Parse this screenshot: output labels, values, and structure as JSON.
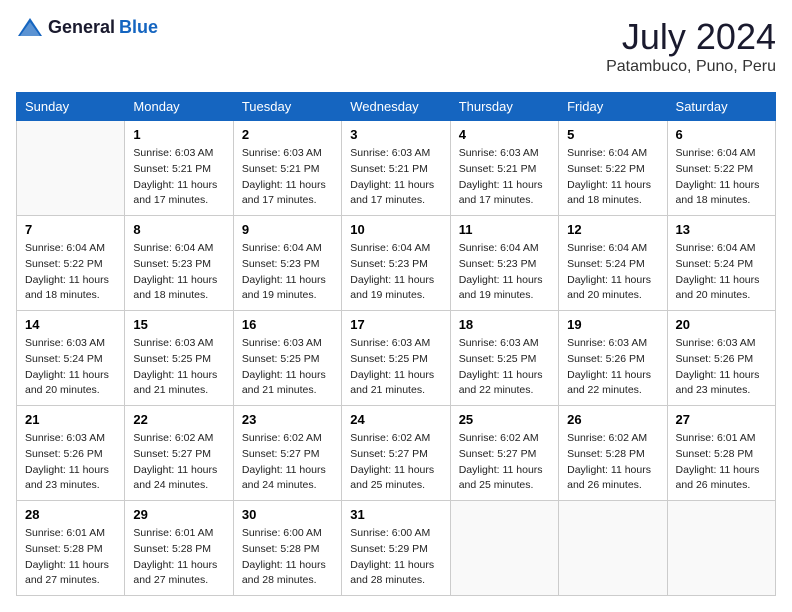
{
  "header": {
    "logo": {
      "general": "General",
      "blue": "Blue"
    },
    "title": "July 2024",
    "location": "Patambuco, Puno, Peru"
  },
  "weekdays": [
    "Sunday",
    "Monday",
    "Tuesday",
    "Wednesday",
    "Thursday",
    "Friday",
    "Saturday"
  ],
  "weeks": [
    [
      {
        "day": "",
        "info": ""
      },
      {
        "day": "1",
        "info": "Sunrise: 6:03 AM\nSunset: 5:21 PM\nDaylight: 11 hours\nand 17 minutes."
      },
      {
        "day": "2",
        "info": "Sunrise: 6:03 AM\nSunset: 5:21 PM\nDaylight: 11 hours\nand 17 minutes."
      },
      {
        "day": "3",
        "info": "Sunrise: 6:03 AM\nSunset: 5:21 PM\nDaylight: 11 hours\nand 17 minutes."
      },
      {
        "day": "4",
        "info": "Sunrise: 6:03 AM\nSunset: 5:21 PM\nDaylight: 11 hours\nand 17 minutes."
      },
      {
        "day": "5",
        "info": "Sunrise: 6:04 AM\nSunset: 5:22 PM\nDaylight: 11 hours\nand 18 minutes."
      },
      {
        "day": "6",
        "info": "Sunrise: 6:04 AM\nSunset: 5:22 PM\nDaylight: 11 hours\nand 18 minutes."
      }
    ],
    [
      {
        "day": "7",
        "info": "Sunrise: 6:04 AM\nSunset: 5:22 PM\nDaylight: 11 hours\nand 18 minutes."
      },
      {
        "day": "8",
        "info": "Sunrise: 6:04 AM\nSunset: 5:23 PM\nDaylight: 11 hours\nand 18 minutes."
      },
      {
        "day": "9",
        "info": "Sunrise: 6:04 AM\nSunset: 5:23 PM\nDaylight: 11 hours\nand 19 minutes."
      },
      {
        "day": "10",
        "info": "Sunrise: 6:04 AM\nSunset: 5:23 PM\nDaylight: 11 hours\nand 19 minutes."
      },
      {
        "day": "11",
        "info": "Sunrise: 6:04 AM\nSunset: 5:23 PM\nDaylight: 11 hours\nand 19 minutes."
      },
      {
        "day": "12",
        "info": "Sunrise: 6:04 AM\nSunset: 5:24 PM\nDaylight: 11 hours\nand 20 minutes."
      },
      {
        "day": "13",
        "info": "Sunrise: 6:04 AM\nSunset: 5:24 PM\nDaylight: 11 hours\nand 20 minutes."
      }
    ],
    [
      {
        "day": "14",
        "info": "Sunrise: 6:03 AM\nSunset: 5:24 PM\nDaylight: 11 hours\nand 20 minutes."
      },
      {
        "day": "15",
        "info": "Sunrise: 6:03 AM\nSunset: 5:25 PM\nDaylight: 11 hours\nand 21 minutes."
      },
      {
        "day": "16",
        "info": "Sunrise: 6:03 AM\nSunset: 5:25 PM\nDaylight: 11 hours\nand 21 minutes."
      },
      {
        "day": "17",
        "info": "Sunrise: 6:03 AM\nSunset: 5:25 PM\nDaylight: 11 hours\nand 21 minutes."
      },
      {
        "day": "18",
        "info": "Sunrise: 6:03 AM\nSunset: 5:25 PM\nDaylight: 11 hours\nand 22 minutes."
      },
      {
        "day": "19",
        "info": "Sunrise: 6:03 AM\nSunset: 5:26 PM\nDaylight: 11 hours\nand 22 minutes."
      },
      {
        "day": "20",
        "info": "Sunrise: 6:03 AM\nSunset: 5:26 PM\nDaylight: 11 hours\nand 23 minutes."
      }
    ],
    [
      {
        "day": "21",
        "info": "Sunrise: 6:03 AM\nSunset: 5:26 PM\nDaylight: 11 hours\nand 23 minutes."
      },
      {
        "day": "22",
        "info": "Sunrise: 6:02 AM\nSunset: 5:27 PM\nDaylight: 11 hours\nand 24 minutes."
      },
      {
        "day": "23",
        "info": "Sunrise: 6:02 AM\nSunset: 5:27 PM\nDaylight: 11 hours\nand 24 minutes."
      },
      {
        "day": "24",
        "info": "Sunrise: 6:02 AM\nSunset: 5:27 PM\nDaylight: 11 hours\nand 25 minutes."
      },
      {
        "day": "25",
        "info": "Sunrise: 6:02 AM\nSunset: 5:27 PM\nDaylight: 11 hours\nand 25 minutes."
      },
      {
        "day": "26",
        "info": "Sunrise: 6:02 AM\nSunset: 5:28 PM\nDaylight: 11 hours\nand 26 minutes."
      },
      {
        "day": "27",
        "info": "Sunrise: 6:01 AM\nSunset: 5:28 PM\nDaylight: 11 hours\nand 26 minutes."
      }
    ],
    [
      {
        "day": "28",
        "info": "Sunrise: 6:01 AM\nSunset: 5:28 PM\nDaylight: 11 hours\nand 27 minutes."
      },
      {
        "day": "29",
        "info": "Sunrise: 6:01 AM\nSunset: 5:28 PM\nDaylight: 11 hours\nand 27 minutes."
      },
      {
        "day": "30",
        "info": "Sunrise: 6:00 AM\nSunset: 5:28 PM\nDaylight: 11 hours\nand 28 minutes."
      },
      {
        "day": "31",
        "info": "Sunrise: 6:00 AM\nSunset: 5:29 PM\nDaylight: 11 hours\nand 28 minutes."
      },
      {
        "day": "",
        "info": ""
      },
      {
        "day": "",
        "info": ""
      },
      {
        "day": "",
        "info": ""
      }
    ]
  ]
}
